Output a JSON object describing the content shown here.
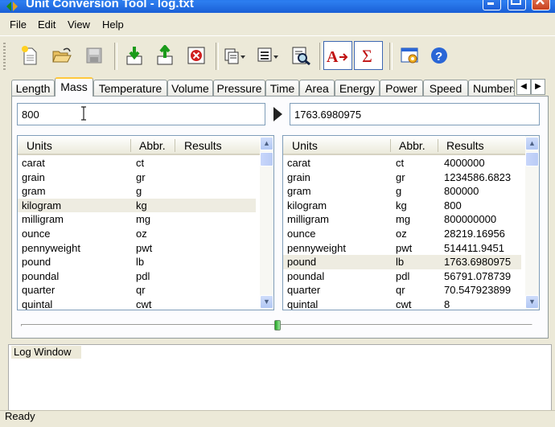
{
  "window": {
    "title": "Unit Conversion Tool - log.txt"
  },
  "menu": [
    "File",
    "Edit",
    "View",
    "Help"
  ],
  "toolbar": {
    "icons": [
      "new-file-icon",
      "open-folder-icon",
      "save-disk-icon",
      "import-green-arrow-icon",
      "export-green-arrow-icon",
      "delete-red-icon",
      "copy-dropdown-icon",
      "list-dropdown-icon",
      "preview-search-icon",
      "font-format-icon",
      "sigma-icon",
      "settings-window-icon",
      "help-icon"
    ]
  },
  "tabs": [
    "Length",
    "Mass",
    "Temperature",
    "Volume",
    "Pressure",
    "Time",
    "Area",
    "Energy",
    "Power",
    "Speed",
    "Numbers"
  ],
  "active_tab": "Mass",
  "input": {
    "value": "800"
  },
  "output": {
    "value": "1763.6980975"
  },
  "headers": {
    "units": "Units",
    "abbr": "Abbr.",
    "results": "Results"
  },
  "left_rows": [
    {
      "unit": "carat",
      "abbr": "ct"
    },
    {
      "unit": "grain",
      "abbr": "gr"
    },
    {
      "unit": "gram",
      "abbr": "g"
    },
    {
      "unit": "kilogram",
      "abbr": "kg"
    },
    {
      "unit": "milligram",
      "abbr": "mg"
    },
    {
      "unit": "ounce",
      "abbr": "oz"
    },
    {
      "unit": "pennyweight",
      "abbr": "pwt"
    },
    {
      "unit": "pound",
      "abbr": "lb"
    },
    {
      "unit": "poundal",
      "abbr": "pdl"
    },
    {
      "unit": "quarter",
      "abbr": "qr"
    },
    {
      "unit": "quintal",
      "abbr": "cwt"
    }
  ],
  "left_selected": 3,
  "right_rows": [
    {
      "unit": "carat",
      "abbr": "ct",
      "result": "4000000"
    },
    {
      "unit": "grain",
      "abbr": "gr",
      "result": "1234586.6823"
    },
    {
      "unit": "gram",
      "abbr": "g",
      "result": "800000"
    },
    {
      "unit": "kilogram",
      "abbr": "kg",
      "result": "800"
    },
    {
      "unit": "milligram",
      "abbr": "mg",
      "result": "800000000"
    },
    {
      "unit": "ounce",
      "abbr": "oz",
      "result": "28219.16956"
    },
    {
      "unit": "pennyweight",
      "abbr": "pwt",
      "result": "514411.9451"
    },
    {
      "unit": "pound",
      "abbr": "lb",
      "result": "1763.6980975"
    },
    {
      "unit": "poundal",
      "abbr": "pdl",
      "result": "56791.078739"
    },
    {
      "unit": "quarter",
      "abbr": "qr",
      "result": "70.547923899"
    },
    {
      "unit": "quintal",
      "abbr": "cwt",
      "result": "8"
    }
  ],
  "right_selected": 7,
  "log": {
    "label": "Log Window"
  },
  "status": {
    "text": "Ready"
  },
  "colors": {
    "titlebar": "#0a5ee0",
    "selected_row": "#eeece1",
    "tab_highlight": "#ffc83c"
  }
}
